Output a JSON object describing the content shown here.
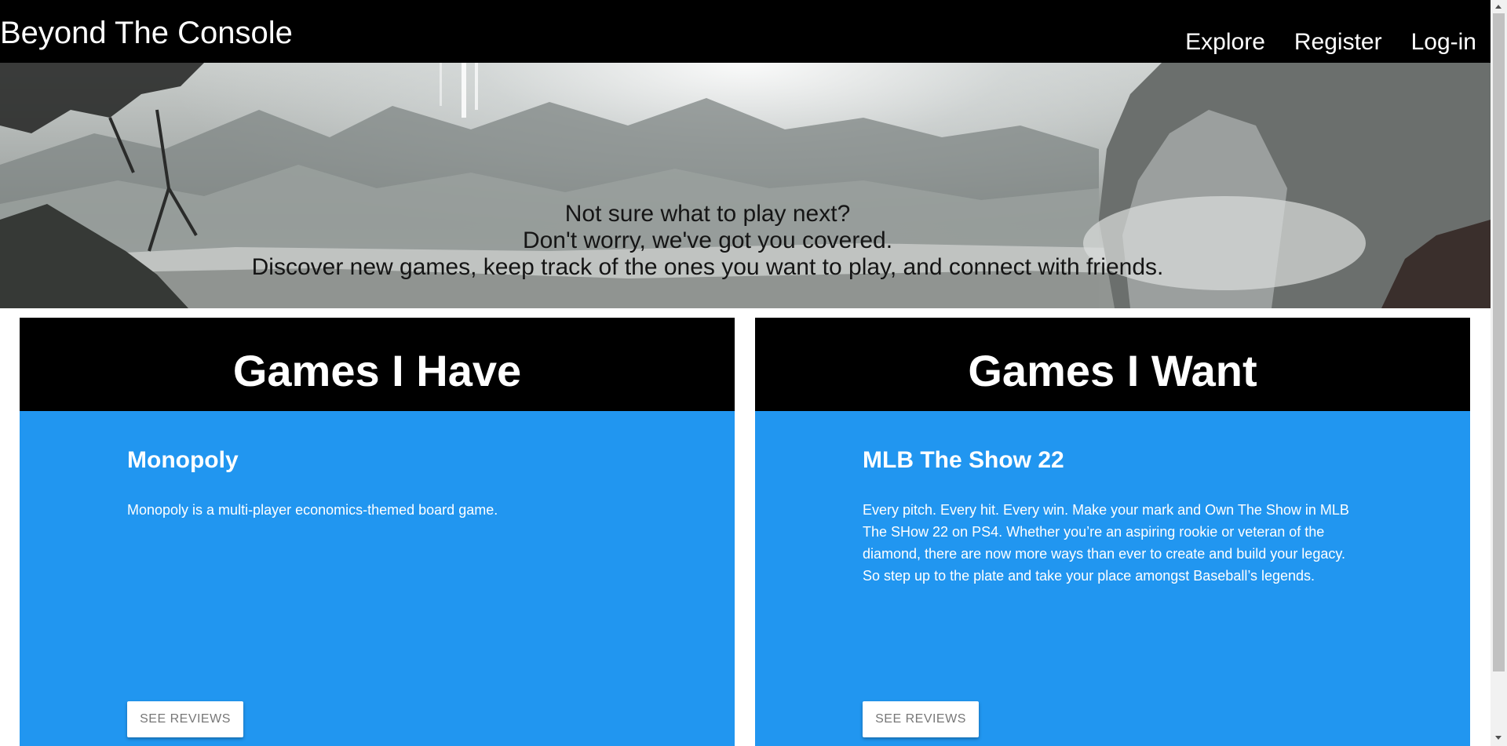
{
  "navbar": {
    "brand": "Beyond The Console",
    "links": [
      {
        "label": "Explore"
      },
      {
        "label": "Register"
      },
      {
        "label": "Log-in"
      }
    ]
  },
  "hero": {
    "lines": [
      "Not sure what to play next?",
      "Don't worry, we've got you covered.",
      "Discover new games, keep track of the ones you want to play, and connect with friends."
    ]
  },
  "cards": [
    {
      "heading": "Games I Have",
      "game_title": "Monopoly",
      "description": "Monopoly is a multi-player economics-themed board game.",
      "button_label": "SEE REVIEWS"
    },
    {
      "heading": "Games I Want",
      "game_title": "MLB The Show 22",
      "description": "Every pitch. Every hit. Every win. Make your mark and Own The Show in MLB The SHow 22 on PS4. Whether you’re an aspiring rookie or veteran of the diamond, there are now more ways than ever to create and build your legacy. So step up to the plate and take your place amongst Baseball’s legends.",
      "button_label": "SEE REVIEWS"
    }
  ],
  "colors": {
    "navbar_bg": "#000000",
    "card_header_bg": "#000000",
    "card_body_bg": "#2196f0",
    "button_bg": "#ffffff"
  }
}
